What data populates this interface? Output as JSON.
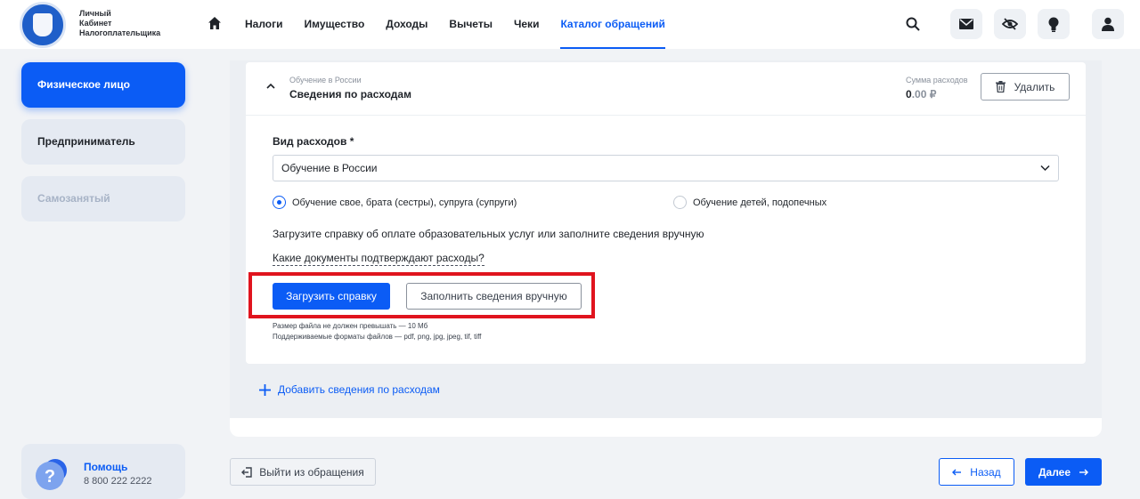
{
  "header": {
    "logo_lines": [
      "Личный",
      "Кабинет",
      "Налогоплательщика"
    ],
    "nav": [
      {
        "label": "Налоги",
        "active": false
      },
      {
        "label": "Имущество",
        "active": false
      },
      {
        "label": "Доходы",
        "active": false
      },
      {
        "label": "Вычеты",
        "active": false
      },
      {
        "label": "Чеки",
        "active": false
      },
      {
        "label": "Каталог обращений",
        "active": true
      }
    ],
    "icons": [
      "search-icon",
      "mail-icon",
      "eye-off-icon",
      "lightbulb-icon",
      "user-icon"
    ]
  },
  "sidebar": {
    "items": [
      {
        "label": "Физическое лицо",
        "state": "active"
      },
      {
        "label": "Предприниматель",
        "state": "normal"
      },
      {
        "label": "Самозанятый",
        "state": "disabled"
      }
    ],
    "help": {
      "title": "Помощь",
      "phone": "8 800 222 2222"
    }
  },
  "card": {
    "category_small": "Обучение в России",
    "title": "Сведения по расходам",
    "sum_label": "Сумма расходов",
    "sum_int": "0",
    "sum_dec": ".00 ₽",
    "delete_label": "Удалить",
    "field_label": "Вид расходов *",
    "select_value": "Обучение в России",
    "radio_self": "Обучение свое, брата (сестры), супруга (супруги)",
    "radio_children": "Обучение детей, подопечных",
    "radio_selected": "self",
    "instruction": "Загрузите справку об оплате образовательных услуг или заполните сведения вручную",
    "which_docs_link": "Какие документы подтверждают расходы?",
    "upload_button": "Загрузить справку",
    "manual_button": "Заполнить сведения вручную",
    "note_size": "Размер файла не должен превышать — 10 Мб",
    "note_formats": "Поддерживаемые форматы файлов — pdf, png, jpg, jpeg, tif, tiff"
  },
  "add_more": "Добавить сведения по расходам",
  "footer": {
    "exit": "Выйти из обращения",
    "back": "Назад",
    "next": "Далее"
  },
  "colors": {
    "accent": "#0b5cf5",
    "highlight": "#e0141e"
  }
}
